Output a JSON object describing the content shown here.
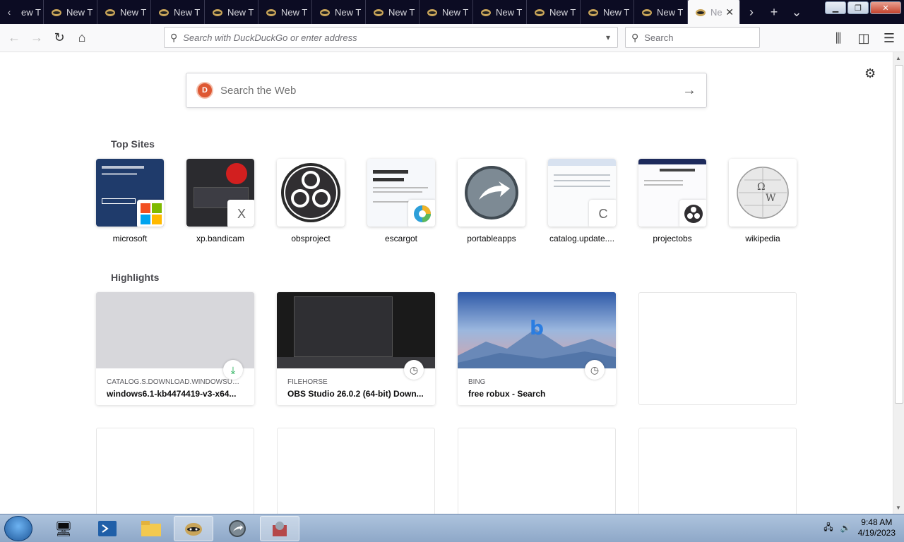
{
  "tabs": {
    "first_partial": "ew T",
    "labels": [
      "New T",
      "New T",
      "New T",
      "New T",
      "New T",
      "New T",
      "New T",
      "New T",
      "New T",
      "New T",
      "New T",
      "New T"
    ],
    "active": "Ne"
  },
  "nav": {
    "url_placeholder": "Search with DuckDuckGo or enter address",
    "search_placeholder": "Search"
  },
  "newtab": {
    "search_placeholder": "Search the Web",
    "top_sites_title": "Top Sites",
    "highlights_title": "Highlights",
    "top_sites": [
      {
        "label": "microsoft"
      },
      {
        "label": "xp.bandicam",
        "badge": "X"
      },
      {
        "label": "obsproject"
      },
      {
        "label": "escargot"
      },
      {
        "label": "portableapps"
      },
      {
        "label": "catalog.update....",
        "badge": "C"
      },
      {
        "label": "projectobs"
      },
      {
        "label": "wikipedia"
      }
    ],
    "highlights": [
      {
        "source": "CATALOG.S.DOWNLOAD.WINDOWSUPDA...",
        "title": "windows6.1-kb4474419-v3-x64..."
      },
      {
        "source": "FILEHORSE",
        "title": "OBS Studio 26.0.2 (64-bit) Down..."
      },
      {
        "source": "BING",
        "title": "free robux - Search"
      }
    ]
  },
  "taskbar": {
    "time": "9:48 AM",
    "date": "4/19/2023"
  }
}
